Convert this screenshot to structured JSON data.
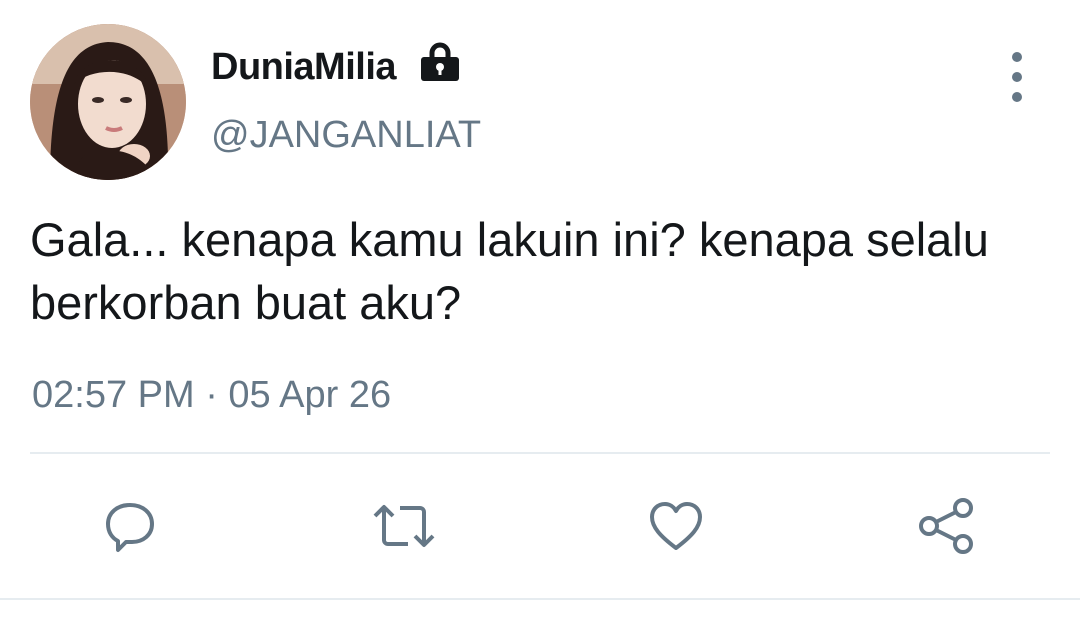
{
  "user": {
    "display_name": "DuniaMilia",
    "handle": "@JANGANLIAT",
    "protected_icon": "lock-icon",
    "avatar_icon": "avatar-photo"
  },
  "tweet": {
    "text": "Gala... kenapa kamu lakuin ini? kenapa selalu berkorban buat aku?",
    "timestamp": "02:57 PM · 05 Apr 26"
  },
  "actions": [
    {
      "icon": "reply-icon"
    },
    {
      "icon": "retweet-icon"
    },
    {
      "icon": "like-icon"
    },
    {
      "icon": "share-icon"
    }
  ],
  "menu": {
    "icon": "more-options-icon"
  },
  "colors": {
    "text_primary": "#14171a",
    "text_secondary": "#657786",
    "divider": "#e6ecf0"
  }
}
